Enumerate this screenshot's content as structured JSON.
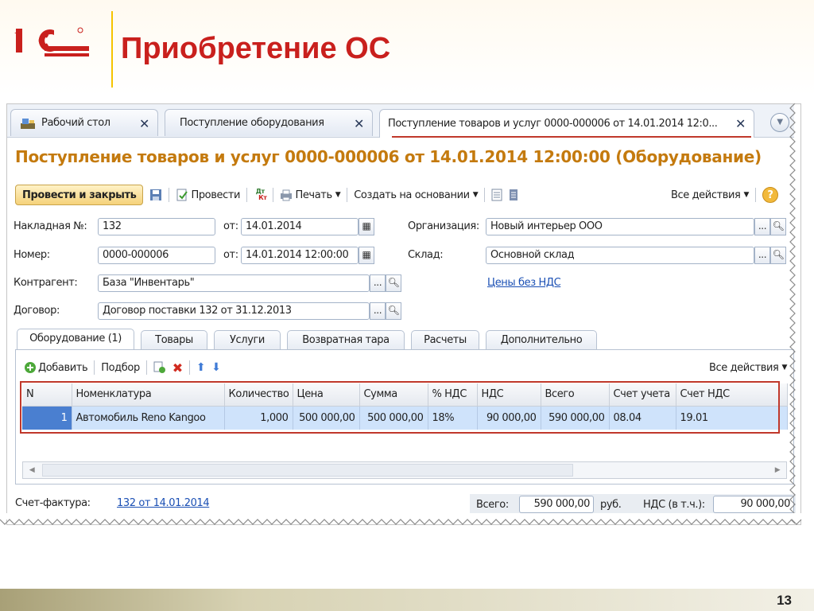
{
  "slide": {
    "title": "Приобретение ОС",
    "page_number": "13"
  },
  "tabs": [
    {
      "label": "Рабочий стол",
      "icon": "desktop-icon"
    },
    {
      "label": "Поступление оборудования"
    },
    {
      "label": "Поступление товаров и услуг 0000-000006 от 14.01.2014 12:0..."
    }
  ],
  "document": {
    "title": "Поступление товаров и услуг 0000-000006 от 14.01.2014 12:00:00 (Оборудование)"
  },
  "toolbar": {
    "post_close": "Провести и закрыть",
    "post": "Провести",
    "print": "Печать",
    "create_based": "Создать на основании",
    "all_actions": "Все действия",
    "dtkt_top": "Дт",
    "dtkt_bottom": "Кт"
  },
  "form": {
    "invoice_label": "Накладная №:",
    "invoice_value": "132",
    "from_label": "от:",
    "invoice_date": "14.01.2014",
    "number_label": "Номер:",
    "number_value": "0000-000006",
    "number_date": "14.01.2014 12:00:00",
    "org_label": "Организация:",
    "org_value": "Новый интерьер ООО",
    "warehouse_label": "Склад:",
    "warehouse_value": "Основной склад",
    "counterparty_label": "Контрагент:",
    "counterparty_value": "База \"Инвентарь\"",
    "prices_link": "Цены без НДС",
    "contract_label": "Договор:",
    "contract_value": "Договор поставки 132 от 31.12.2013",
    "ellipsis": "..."
  },
  "subtabs": [
    "Оборудование (1)",
    "Товары",
    "Услуги",
    "Возвратная тара",
    "Расчеты",
    "Дополнительно"
  ],
  "panel_toolbar": {
    "add": "Добавить",
    "pick": "Подбор",
    "all_actions": "Все действия"
  },
  "table": {
    "headers": [
      "N",
      "Номенклатура",
      "Количество",
      "Цена",
      "Сумма",
      "% НДС",
      "НДС",
      "Всего",
      "Счет учета",
      "Счет НДС"
    ],
    "rows": [
      [
        "1",
        "Автомобиль Reno Kangoo",
        "1,000",
        "500 000,00",
        "500 000,00",
        "18%",
        "90 000,00",
        "590 000,00",
        "08.04",
        "19.01"
      ]
    ]
  },
  "footer": {
    "invoice_label": "Счет-фактура:",
    "invoice_link": "132 от 14.01.2014",
    "total_label": "Всего:",
    "total_value": "590 000,00",
    "currency": "руб.",
    "vat_label": "НДС (в т.ч.):",
    "vat_value": "90 000,00"
  },
  "colors": {
    "title_red": "#c9201d",
    "doc_title": "#c47a0e",
    "accent_yellow": "#f5c400",
    "highlight": "#c0382b"
  }
}
